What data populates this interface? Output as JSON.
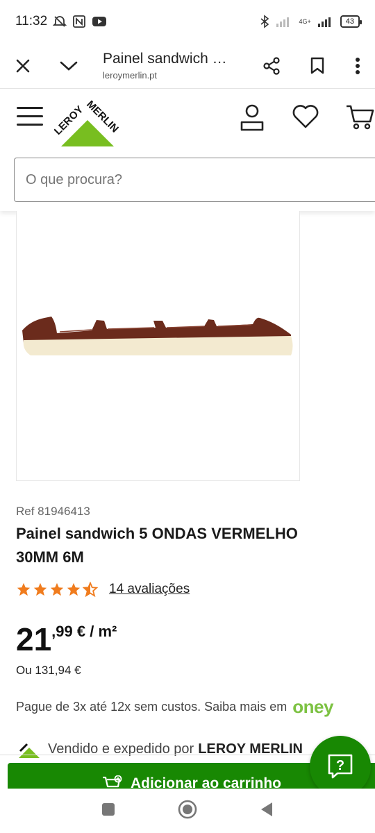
{
  "status_bar": {
    "time": "11:32",
    "battery": "43",
    "network": "4G+"
  },
  "browser": {
    "title": "Painel sandwich …",
    "url": "leroymerlin.pt"
  },
  "site_header": {
    "logo_text_top": "LEROY",
    "logo_text_bottom": "MERLIN",
    "search_placeholder": "O que procura?"
  },
  "product": {
    "ref": "Ref 81946413",
    "title": "Painel sandwich 5 ONDAS VERMELHO 30MM 6M",
    "rating": 4.5,
    "reviews_label": "14 avaliações",
    "price_integer": "21",
    "price_rest": ",99 € / m²",
    "alt_price": "Ou 131,94 €",
    "installments_text": "Pague de 3x até 12x sem custos. Saiba mais em",
    "installments_brand": "oney",
    "seller_prefix": "Vendido e expedido por",
    "seller_name": "LEROY MERLIN"
  },
  "actions": {
    "add_to_cart": "Adicionar ao carrinho"
  },
  "colors": {
    "brand_green": "#188803",
    "logo_green": "#78be20",
    "star_orange": "#f07c1e",
    "oney_green": "#7dc243",
    "panel_brown": "#6b2b1c"
  }
}
